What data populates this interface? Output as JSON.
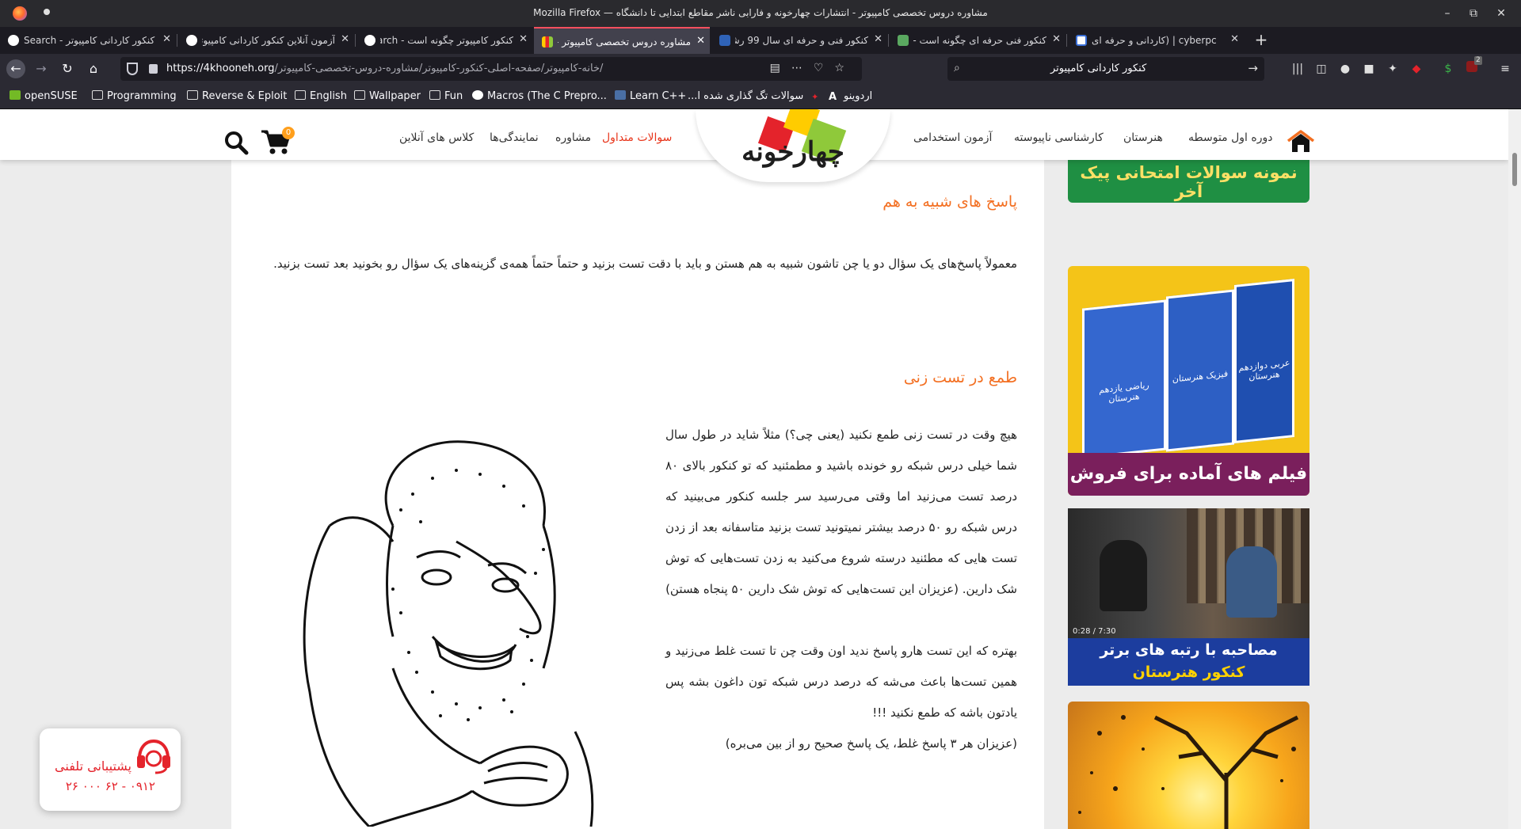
{
  "window": {
    "title": "مشاوره دروس تخصصی کامپیوتر - انتشارات چهارخونه و فارابی ناشر مقاطع ابتدایی تا دانشگاه — Mozilla Firefox"
  },
  "tabs": [
    {
      "label": "کنکور کاردانی کامپیوتر - Search",
      "favicon": "google-icon",
      "active": false
    },
    {
      "label": "آزمون آنلاین کنکور کاردانی کامپیوتر",
      "favicon": "google-icon",
      "active": false
    },
    {
      "label": "کنکور کامپیوتر چگونه است - Search",
      "favicon": "google-icon",
      "active": false
    },
    {
      "label": "مشاوره دروس تخصصی کامپیوتر - ا",
      "favicon": "site-icon",
      "active": true
    },
    {
      "label": "کنکور فنی و حرفه ای سال 99 رشته",
      "favicon": "sanjesh-icon",
      "active": false
    },
    {
      "label": "کنکور فنی حرفه ای چگونه است - م",
      "favicon": "doc-icon",
      "active": false
    },
    {
      "label": "cyberpc | (کاردانی و حرفه ای",
      "favicon": "cyberpc-icon",
      "active": false
    }
  ],
  "navbar": {
    "url_host": "https://4khooneh.org",
    "url_path": "/خانه-کامپیوتر/صفحه-اصلی-کنکور-کامپیوتر/مشاوره-دروس-تخصصی-کامپیوتر/",
    "search_value": "کنکور کاردانی کامپیوتر",
    "ublock_count": "2"
  },
  "bookmarks": [
    {
      "label": "openSUSE",
      "icon": "opensuse-icon"
    },
    {
      "label": "Programming",
      "icon": "folder-icon"
    },
    {
      "label": "Reverse & Eploit",
      "icon": "folder-icon"
    },
    {
      "label": "English",
      "icon": "folder-icon"
    },
    {
      "label": "Wallpaper",
      "icon": "folder-icon"
    },
    {
      "label": "Fun",
      "icon": "folder-icon"
    },
    {
      "label": "Macros (The C Prepro...",
      "icon": "site-icon"
    },
    {
      "label": "Learn C++",
      "icon": "cpp-icon"
    },
    {
      "label": "سوالات تگ گذاری شده ا...",
      "icon": "wings-icon"
    },
    {
      "label": "اردوینو",
      "icon": "a-icon"
    }
  ],
  "site": {
    "logo_text": "چهارخونه",
    "nav": [
      {
        "label": "دوره اول متوسطه"
      },
      {
        "label": "هنرستان"
      },
      {
        "label": "کارشناسی ناپیوسته"
      },
      {
        "label": "آزمون استخدامی"
      },
      {
        "label": "سوالات متداول"
      },
      {
        "label": "مشاوره"
      },
      {
        "label": "نمایندگی‌ها"
      },
      {
        "label": "کلاس های آنلاین"
      }
    ],
    "cart_count": "0"
  },
  "article": {
    "section1_title": "پاسخ های شبیه به هم",
    "section1_text": "معمولاً پاسخ‌های یک سؤال دو یا چن تاشون شبیه به هم هستن و باید با دقت تست بزنید و حتماً حتماً همه‌ی گزینه‌های یک سؤال رو بخونید بعد تست بزنید.",
    "section2_title": "طمع در تست زنی",
    "section2_text": "هیچ وقت در تست زنی طمع نکنید (یعنی چی؟) مثلاً شاید در طول سال شما خیلی درس شبکه رو خونده باشید و مطمئنید که تو کنکور بالای ۸۰ درصد تست می‌زنید اما وقتی می‌رسید سر جلسه کنکور می‌بینید که درس شبکه رو ۵۰ درصد  بیشتر نمیتونید تست بزنید متاسفانه بعد از زدن  تست هایی که مطئنید درسته شروع می‌کنید به زدن تست‌هایی که توش شک دارین. (عزیزان این تست‌هایی که توش شک دارین ۵۰ پنجاه هستن)",
    "section2_text2": "بهتره که این تست هارو پاسخ ندید اون وقت چن تا تست غلط می‌زنید و همین تست‌ها باعث می‌شه که درصد درس شبکه تون داغون بشه پس یادتون باشه که طمع نکنید !!!",
    "section2_text3": "(عزیزان هر ۳ پاسخ غلط، یک پاسخ صحیح رو از بین می‌بره)"
  },
  "sidebar_ads": [
    {
      "caption": "نمونه سوالات امتحانی پیک آخر"
    },
    {
      "caption": "فیلم های آماده برای فروش",
      "book1": "عربی دوازدهم هنرستان",
      "book2": "فیزیک هنرستان",
      "book3": "ریاضی یازدهم هنرستان"
    },
    {
      "caption1": "مصاحبه با رتبه های برتر",
      "caption2": "کنکور هنرستان",
      "video_time": "0:28 / 7:30"
    },
    {
      "caption": ""
    }
  ],
  "support": {
    "label": "پشتیبانی تلفنی",
    "phone": "۰۹۱۲ - ۶۲ ۰۰۰ ۲۶"
  },
  "colors": {
    "accent_orange": "#f36f21",
    "nav_highlight": "#e8361c",
    "ad_blue": "#1c3d9e",
    "ad_purple": "#7a1f5c"
  }
}
